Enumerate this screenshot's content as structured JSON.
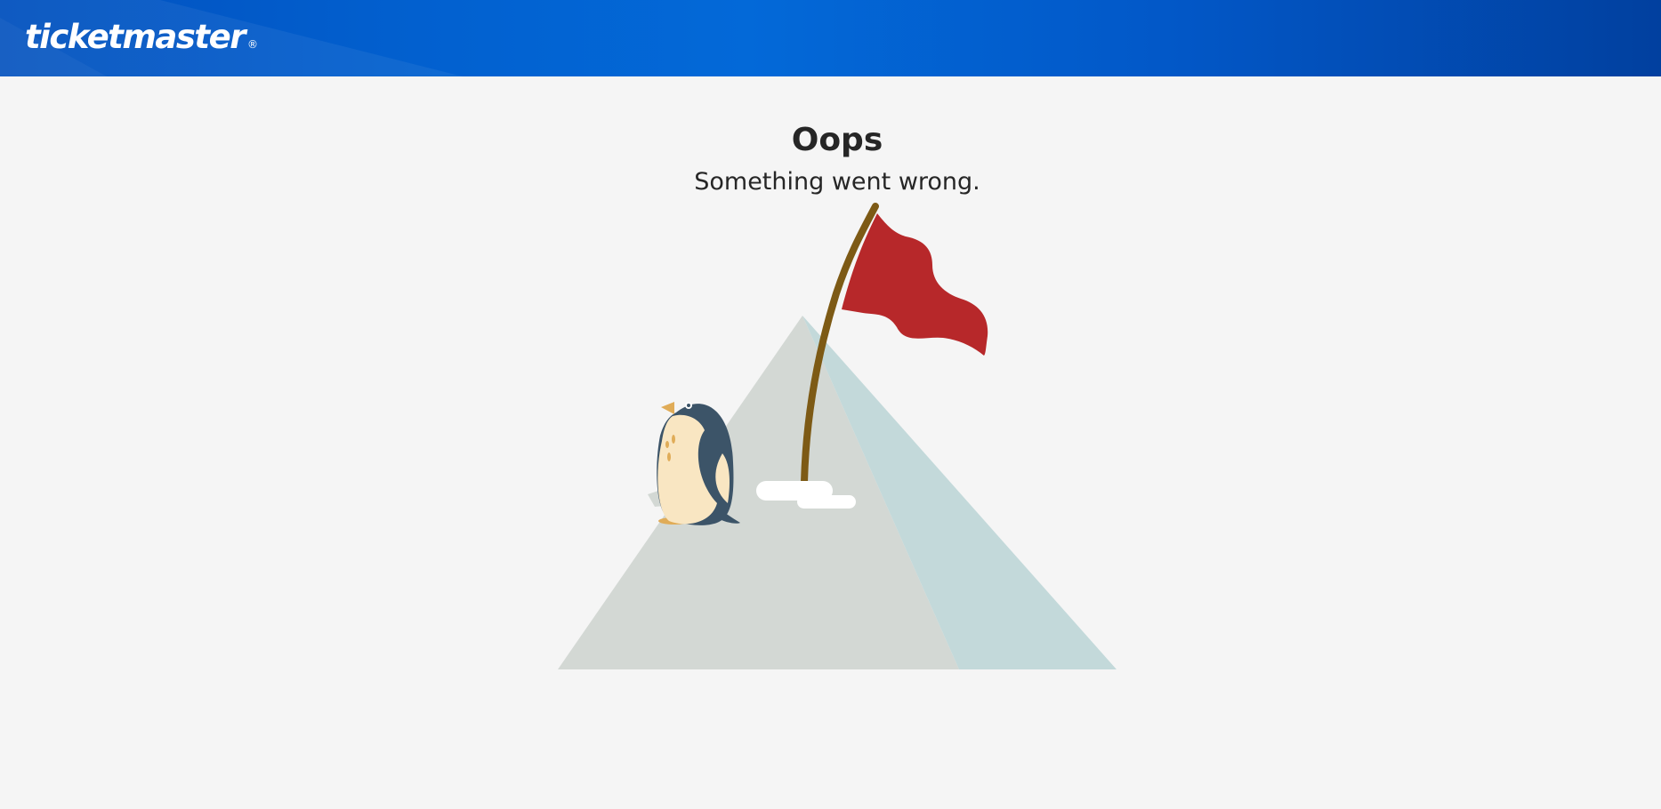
{
  "header": {
    "logo_text": "ticketmaster",
    "logo_mark": "®",
    "background_color": "#0260cf"
  },
  "error": {
    "title": "Oops",
    "message": "Something went wrong."
  },
  "illustration": {
    "subject": "penguin beside a mountain with a red flag",
    "colors": {
      "mountain_left": "#d3d8d4",
      "mountain_right": "#c3d9da",
      "flag": "#b7282a",
      "pole": "#7d5a15",
      "penguin_body": "#3c5468",
      "penguin_belly": "#f9e6c2",
      "snow": "#ffffff"
    }
  }
}
